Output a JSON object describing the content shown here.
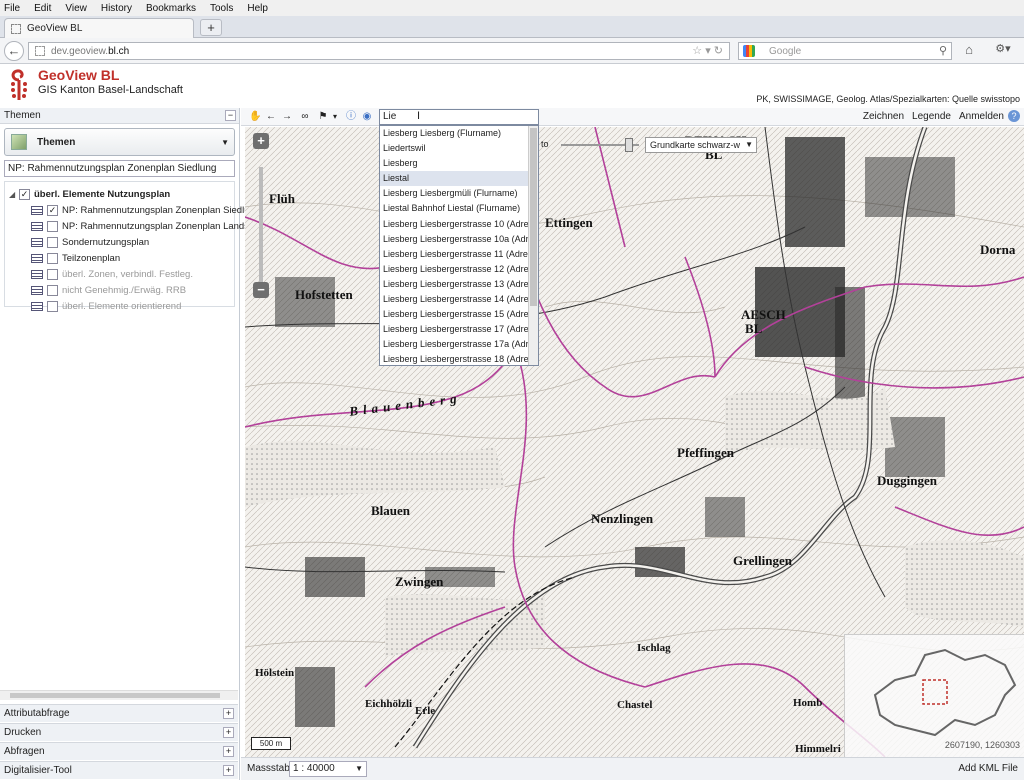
{
  "browser": {
    "menu": [
      "File",
      "Edit",
      "View",
      "History",
      "Bookmarks",
      "Tools",
      "Help"
    ],
    "tab_title": "GeoView BL",
    "new_tab": "+",
    "url_prefix": "dev.geoview.",
    "url_domain": "bl.ch",
    "search_placeholder": "Google"
  },
  "app": {
    "title": "GeoView BL",
    "subtitle": "GIS Kanton Basel-Landschaft",
    "credits": "PK, SWISSIMAGE, Geolog. Atlas/Spezialkarten: Quelle swisstopo"
  },
  "left_panel": {
    "header": "Themen",
    "themen_dropdown": "Themen",
    "active_layer_field": "NP: Rahmennutzungsplan Zonenplan Siedlung",
    "tree": [
      {
        "label": "überl. Elemente Nutzungsplan",
        "level": 0,
        "checked": true,
        "bold": true,
        "grey": false
      },
      {
        "label": "NP: Rahmennutzungsplan Zonenplan Siedlung",
        "level": 1,
        "checked": true,
        "bold": false,
        "grey": false
      },
      {
        "label": "NP: Rahmennutzungsplan Zonenplan Landschaft",
        "level": 1,
        "checked": false,
        "bold": false,
        "grey": false
      },
      {
        "label": "Sondernutzungsplan",
        "level": 1,
        "checked": false,
        "bold": false,
        "grey": false
      },
      {
        "label": "Teilzonenplan",
        "level": 1,
        "checked": false,
        "bold": false,
        "grey": false
      },
      {
        "label": "überl. Zonen, verbindl. Festleg.",
        "level": 1,
        "checked": false,
        "bold": false,
        "grey": true
      },
      {
        "label": "nicht Genehmig./Erwäg. RRB",
        "level": 1,
        "checked": false,
        "bold": false,
        "grey": true
      },
      {
        "label": "überl. Elemente orientierend",
        "level": 1,
        "checked": false,
        "bold": false,
        "grey": true
      }
    ],
    "accordion": [
      "Attributabfrage",
      "Drucken",
      "Abfragen",
      "Digitalisier-Tool"
    ]
  },
  "map_toolbar": {
    "search_value": "Lie",
    "links": [
      "Zeichnen",
      "Legende",
      "Anmelden"
    ]
  },
  "search_results": [
    "Liesberg Liesberg (Flurname)",
    "Liedertswil",
    "Liesberg",
    "Liestal",
    "Liesberg Liesbergmüli (Flurname)",
    "Liestal Bahnhof Liestal (Flurname)",
    "Liesberg Liesbergerstrasse 10 (Adresse)",
    "Liesberg Liesbergerstrasse 10a (Adresse)",
    "Liesberg Liesbergerstrasse 11 (Adresse)",
    "Liesberg Liesbergerstrasse 12 (Adresse)",
    "Liesberg Liesbergerstrasse 13 (Adresse)",
    "Liesberg Liesbergerstrasse 14 (Adresse)",
    "Liesberg Liesbergerstrasse 15 (Adresse)",
    "Liesberg Liesbergerstrasse 17 (Adresse)",
    "Liesberg Liesbergerstrasse 17a (Adresse)",
    "Liesberg Liesbergerstrasse 18 (Adresse)"
  ],
  "selected_result": "Liestal",
  "map": {
    "basemap": "Grundkarte schwarz-w",
    "opacity_label": "to",
    "scalebar": "500 m",
    "coords": "2607190, 1260303",
    "places": [
      {
        "name": "REINACH",
        "size": "lg"
      },
      {
        "name": "BL",
        "size": "lg"
      },
      {
        "name": "Ettingen",
        "size": "lg"
      },
      {
        "name": "AESCH",
        "size": "lg"
      },
      {
        "name": "BL",
        "size": "lg"
      },
      {
        "name": "Hofstetten",
        "size": "lg"
      },
      {
        "name": "Flüh",
        "size": "lg"
      },
      {
        "name": "Dorna",
        "size": "lg"
      },
      {
        "name": "Pfeffingen",
        "size": "lg"
      },
      {
        "name": "Duggingen",
        "size": "lg"
      },
      {
        "name": "Blauen",
        "size": "lg"
      },
      {
        "name": "Nenzlingen",
        "size": "lg"
      },
      {
        "name": "Zwingen",
        "size": "lg"
      },
      {
        "name": "Grellingen",
        "size": "lg"
      },
      {
        "name": "Blauenberg",
        "size": "lg"
      },
      {
        "name": "Hölstein",
        "size": "sm"
      },
      {
        "name": "Himmelri",
        "size": "sm"
      },
      {
        "name": "Eichhölzli",
        "size": "sm"
      },
      {
        "name": "Erle",
        "size": "sm"
      },
      {
        "name": "Ischlag",
        "size": "sm"
      },
      {
        "name": "Chastel",
        "size": "sm"
      },
      {
        "name": "Homb",
        "size": "sm"
      }
    ]
  },
  "bottom": {
    "scale_label": "Massstab:",
    "scale_value": "1 : 40000",
    "add_kml": "Add KML File"
  }
}
